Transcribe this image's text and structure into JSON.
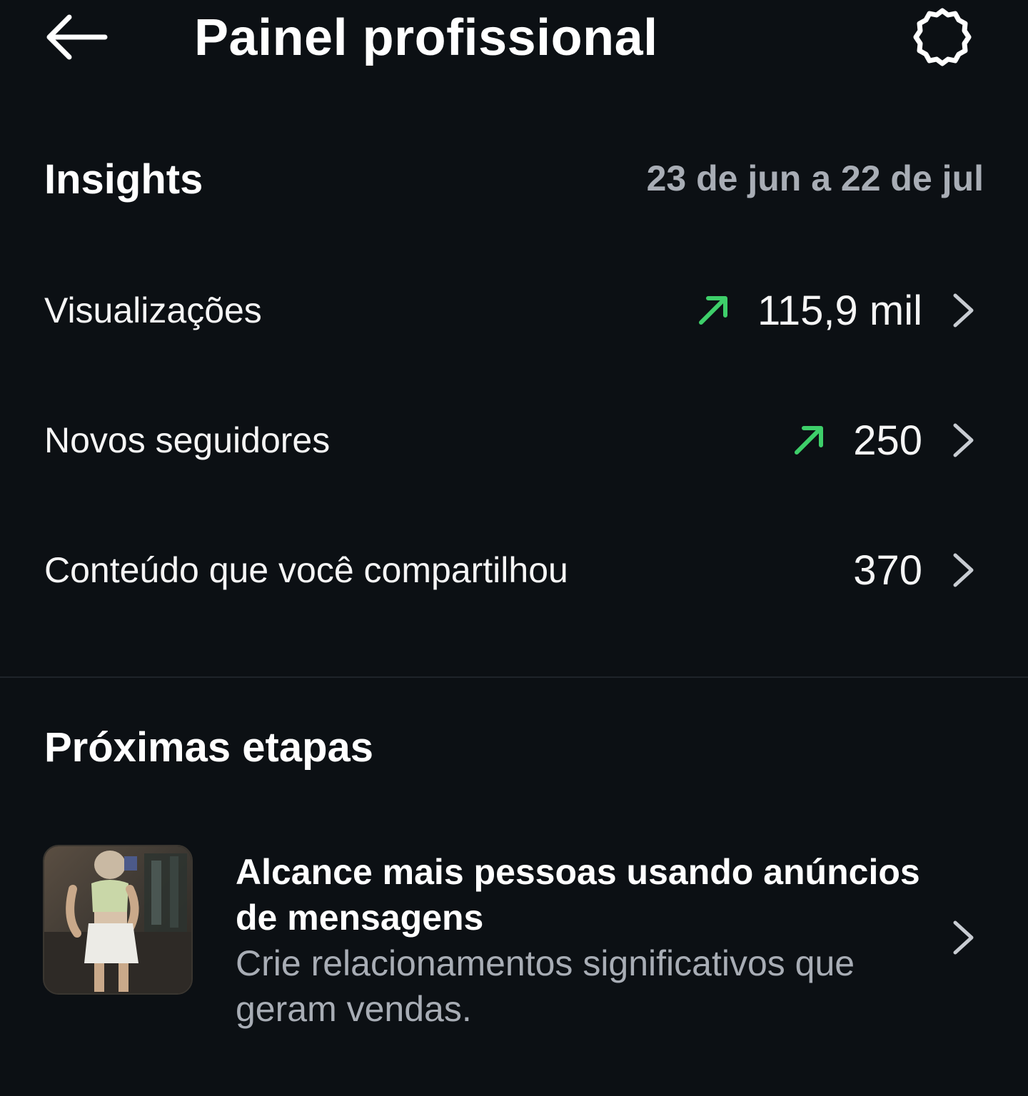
{
  "header": {
    "title": "Painel profissional",
    "back_icon": "arrow-left-icon",
    "settings_icon": "gear-icon"
  },
  "insights": {
    "title": "Insights",
    "date_range": "23 de jun a 22 de jul",
    "metrics": [
      {
        "label": "Visualizações",
        "value": "115,9 mil",
        "trend": "up"
      },
      {
        "label": "Novos seguidores",
        "value": "250",
        "trend": "up"
      },
      {
        "label": "Conteúdo que você compartilhou",
        "value": "370",
        "trend": "none"
      }
    ]
  },
  "next_steps": {
    "title": "Próximas etapas",
    "card": {
      "title": "Alcance mais pessoas usando anúncios de mensagens",
      "subtitle": "Crie relacionamentos significativos que geram vendas."
    }
  },
  "colors": {
    "background": "#0c1014",
    "trend_up": "#3ecf6a",
    "secondary_text": "#a8adb5"
  }
}
